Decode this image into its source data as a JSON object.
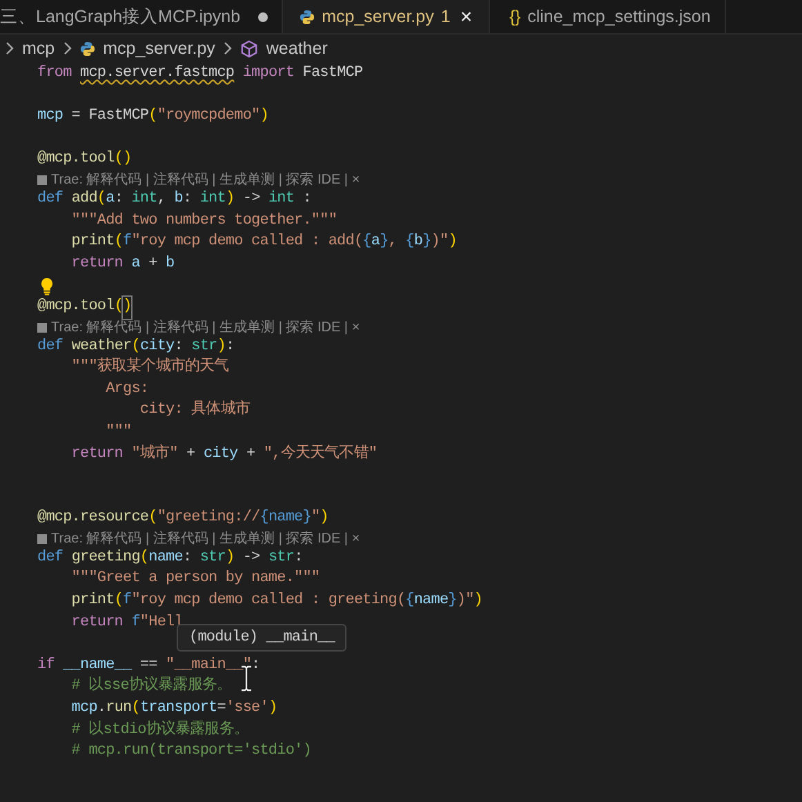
{
  "tabs": [
    {
      "label": "三、LangGraph接入MCP.ipynb",
      "kind": "notebook",
      "selected": false,
      "modified": true
    },
    {
      "label": "mcp_server.py",
      "kind": "python",
      "selected": true,
      "modified": false,
      "problems": "1",
      "close": "×"
    },
    {
      "label": "cline_mcp_settings.json",
      "kind": "json",
      "icon_text": "{}",
      "selected": false,
      "modified": false
    }
  ],
  "breadcrumb": [
    {
      "label": "mcp",
      "kind": "folder"
    },
    {
      "label": "mcp_server.py",
      "kind": "file"
    },
    {
      "label": "weather",
      "kind": "symbol"
    }
  ],
  "editor": {
    "lines": [
      {
        "kind": "code",
        "tokens": [
          {
            "text": "from ",
            "kind": "kw"
          },
          {
            "text": "mcp.server.fastmcp",
            "kind": "sq"
          },
          {
            "text": " import",
            "kind": "kw"
          },
          {
            "text": " FastMCP",
            "kind": "op"
          }
        ]
      },
      {
        "kind": "blank"
      },
      {
        "kind": "code",
        "tokens": [
          {
            "text": "mcp",
            "kind": "var"
          },
          {
            "text": " = FastMCP",
            "kind": "op"
          },
          {
            "text": "(",
            "kind": "b1"
          },
          {
            "text": "\"roymcpdemo\"",
            "kind": "str"
          },
          {
            "text": ")",
            "kind": "b1"
          }
        ]
      },
      {
        "kind": "blank"
      },
      {
        "kind": "code",
        "tokens": [
          {
            "text": "@mcp.tool",
            "kind": "dec"
          },
          {
            "text": "()",
            "kind": "b1"
          }
        ]
      },
      {
        "kind": "codelens",
        "text": "Trae: 解释代码 | 注释代码 | 生成单测 | 探索 IDE | ×"
      },
      {
        "kind": "code",
        "tokens": [
          {
            "text": "def ",
            "kind": "def"
          },
          {
            "text": "add",
            "kind": "fn"
          },
          {
            "text": "(",
            "kind": "b1"
          },
          {
            "text": "a",
            "kind": "var"
          },
          {
            "text": ": ",
            "kind": "op"
          },
          {
            "text": "int",
            "kind": "type"
          },
          {
            "text": ", ",
            "kind": "op"
          },
          {
            "text": "b",
            "kind": "var"
          },
          {
            "text": ": ",
            "kind": "op"
          },
          {
            "text": "int",
            "kind": "type"
          },
          {
            "text": ")",
            "kind": "b1"
          },
          {
            "text": " -> ",
            "kind": "op"
          },
          {
            "text": "int",
            "kind": "type"
          },
          {
            "text": " :",
            "kind": "op"
          }
        ]
      },
      {
        "kind": "code",
        "tokens": [
          {
            "text": "    \"\"\"Add two numbers together.\"\"\"",
            "kind": "str"
          }
        ]
      },
      {
        "kind": "code",
        "tokens": [
          {
            "text": "    print",
            "kind": "fn"
          },
          {
            "text": "(",
            "kind": "b1"
          },
          {
            "text": "f",
            "kind": "def"
          },
          {
            "text": "\"roy mcp demo called : add(",
            "kind": "str"
          },
          {
            "text": "{",
            "kind": "fb"
          },
          {
            "text": "a",
            "kind": "var"
          },
          {
            "text": "}",
            "kind": "fb"
          },
          {
            "text": ", ",
            "kind": "str"
          },
          {
            "text": "{",
            "kind": "fb"
          },
          {
            "text": "b",
            "kind": "var"
          },
          {
            "text": "}",
            "kind": "fb"
          },
          {
            "text": ")\"",
            "kind": "str"
          },
          {
            "text": ")",
            "kind": "b1"
          }
        ]
      },
      {
        "kind": "code",
        "tokens": [
          {
            "text": "    return ",
            "kind": "kw"
          },
          {
            "text": "a",
            "kind": "var"
          },
          {
            "text": " + ",
            "kind": "op"
          },
          {
            "text": "b",
            "kind": "var"
          }
        ]
      },
      {
        "kind": "bulb"
      },
      {
        "kind": "code",
        "tokens": [
          {
            "text": "@mcp.tool",
            "kind": "dec"
          },
          {
            "text": "(",
            "kind": "b1"
          },
          {
            "text": ")",
            "kind": "box"
          }
        ]
      },
      {
        "kind": "codelens",
        "text": "Trae: 解释代码 | 注释代码 | 生成单测 | 探索 IDE | ×"
      },
      {
        "kind": "code",
        "tokens": [
          {
            "text": "def ",
            "kind": "def"
          },
          {
            "text": "weather",
            "kind": "fn"
          },
          {
            "text": "(",
            "kind": "b1"
          },
          {
            "text": "city",
            "kind": "var"
          },
          {
            "text": ": ",
            "kind": "op"
          },
          {
            "text": "str",
            "kind": "type"
          },
          {
            "text": ")",
            "kind": "b1"
          },
          {
            "text": ":",
            "kind": "op"
          }
        ]
      },
      {
        "kind": "code",
        "tokens": [
          {
            "text": "    \"\"\"获取某个城市的天气",
            "kind": "str"
          }
        ]
      },
      {
        "kind": "code",
        "tokens": [
          {
            "text": "        Args:",
            "kind": "str"
          }
        ]
      },
      {
        "kind": "code",
        "tokens": [
          {
            "text": "            city: 具体城市",
            "kind": "str"
          }
        ]
      },
      {
        "kind": "code",
        "tokens": [
          {
            "text": "        \"\"\"",
            "kind": "str"
          }
        ]
      },
      {
        "kind": "code",
        "tokens": [
          {
            "text": "    return ",
            "kind": "kw"
          },
          {
            "text": "\"城市\"",
            "kind": "str"
          },
          {
            "text": " + ",
            "kind": "op"
          },
          {
            "text": "city",
            "kind": "var"
          },
          {
            "text": " + ",
            "kind": "op"
          },
          {
            "text": "\",今天天气不错\"",
            "kind": "str"
          }
        ]
      },
      {
        "kind": "blank"
      },
      {
        "kind": "blank"
      },
      {
        "kind": "code",
        "tokens": [
          {
            "text": "@mcp.resource",
            "kind": "dec"
          },
          {
            "text": "(",
            "kind": "b1"
          },
          {
            "text": "\"greeting://",
            "kind": "str"
          },
          {
            "text": "{name}",
            "kind": "fb"
          },
          {
            "text": "\"",
            "kind": "str"
          },
          {
            "text": ")",
            "kind": "b1"
          }
        ]
      },
      {
        "kind": "codelens",
        "text": "Trae: 解释代码 | 注释代码 | 生成单测 | 探索 IDE | ×"
      },
      {
        "kind": "code",
        "tokens": [
          {
            "text": "def ",
            "kind": "def"
          },
          {
            "text": "greeting",
            "kind": "fn"
          },
          {
            "text": "(",
            "kind": "b1"
          },
          {
            "text": "name",
            "kind": "var"
          },
          {
            "text": ": ",
            "kind": "op"
          },
          {
            "text": "str",
            "kind": "type"
          },
          {
            "text": ")",
            "kind": "b1"
          },
          {
            "text": " -> ",
            "kind": "op"
          },
          {
            "text": "str",
            "kind": "type"
          },
          {
            "text": ":",
            "kind": "op"
          }
        ]
      },
      {
        "kind": "code",
        "tokens": [
          {
            "text": "    \"\"\"Greet a person by name.\"\"\"",
            "kind": "str"
          }
        ]
      },
      {
        "kind": "code",
        "tokens": [
          {
            "text": "    print",
            "kind": "fn"
          },
          {
            "text": "(",
            "kind": "b1"
          },
          {
            "text": "f",
            "kind": "def"
          },
          {
            "text": "\"roy mcp demo called : greeting(",
            "kind": "str"
          },
          {
            "text": "{",
            "kind": "fb"
          },
          {
            "text": "name",
            "kind": "var"
          },
          {
            "text": "}",
            "kind": "fb"
          },
          {
            "text": ")\"",
            "kind": "str"
          },
          {
            "text": ")",
            "kind": "b1"
          }
        ]
      },
      {
        "kind": "code",
        "tokens": [
          {
            "text": "    return ",
            "kind": "kw"
          },
          {
            "text": "f",
            "kind": "def"
          },
          {
            "text": "\"Hell",
            "kind": "str"
          }
        ]
      },
      {
        "kind": "blank"
      },
      {
        "kind": "code",
        "tokens": [
          {
            "text": "if ",
            "kind": "kw"
          },
          {
            "text": "__name__",
            "kind": "var"
          },
          {
            "text": " == ",
            "kind": "op"
          },
          {
            "text": "\"__main__\"",
            "kind": "str"
          },
          {
            "text": ":",
            "kind": "op"
          }
        ]
      },
      {
        "kind": "code",
        "tokens": [
          {
            "text": "    # 以sse协议暴露服务。",
            "kind": "cmt"
          }
        ]
      },
      {
        "kind": "code",
        "tokens": [
          {
            "text": "    mcp",
            "kind": "var"
          },
          {
            "text": ".",
            "kind": "op"
          },
          {
            "text": "run",
            "kind": "fn"
          },
          {
            "text": "(",
            "kind": "b1"
          },
          {
            "text": "transport",
            "kind": "var"
          },
          {
            "text": "=",
            "kind": "op"
          },
          {
            "text": "'sse'",
            "kind": "str"
          },
          {
            "text": ")",
            "kind": "b1"
          }
        ]
      },
      {
        "kind": "code",
        "tokens": [
          {
            "text": "    # 以stdio协议暴露服务。",
            "kind": "cmt"
          }
        ]
      },
      {
        "kind": "code",
        "tokens": [
          {
            "text": "    # mcp.run(transport='stdio')",
            "kind": "cmt"
          }
        ]
      }
    ],
    "hover": {
      "text": "(module) __main__"
    }
  }
}
